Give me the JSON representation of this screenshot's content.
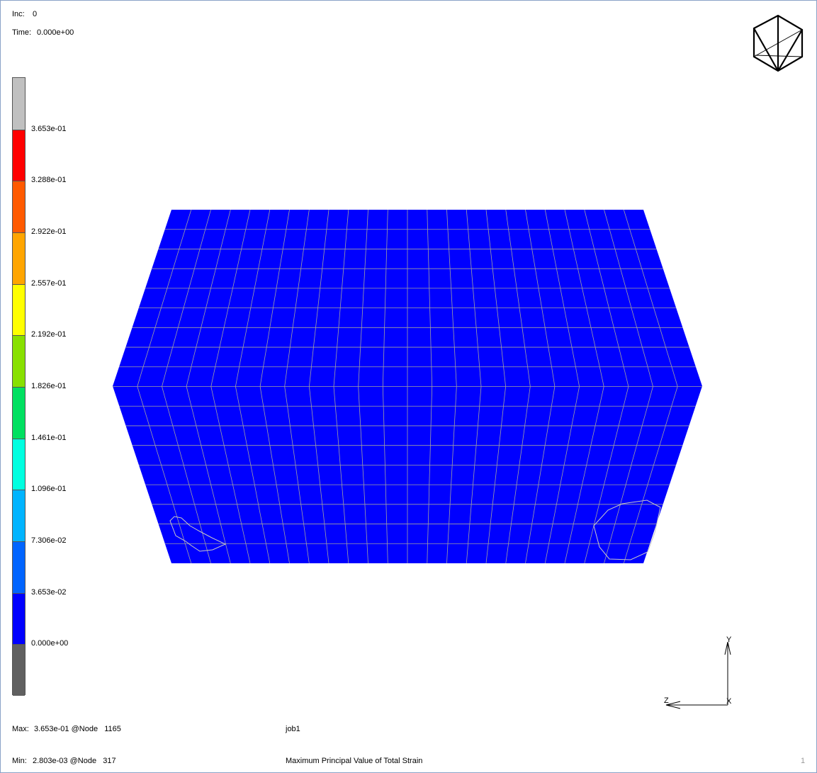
{
  "header": {
    "inc_label": "Inc:",
    "inc_value": "0",
    "time_label": "Time:",
    "time_value": "0.000e+00"
  },
  "legend": {
    "colors": [
      "#c0c0c0",
      "#ff0000",
      "#ff5a00",
      "#ffa500",
      "#ffff00",
      "#88e000",
      "#00e060",
      "#00ffe0",
      "#00b4ff",
      "#0064ff",
      "#0000ff",
      "#606060"
    ],
    "labels": [
      "3.653e-01",
      "3.288e-01",
      "2.922e-01",
      "2.557e-01",
      "2.192e-01",
      "1.826e-01",
      "1.461e-01",
      "1.096e-01",
      "7.306e-02",
      "3.653e-02",
      "0.000e+00"
    ]
  },
  "model": {
    "fill_color": "#0000ff",
    "mesh_line_color": "#a0a0a0"
  },
  "axes": {
    "y_label": "Y",
    "z_label": "Z",
    "x_label": "X"
  },
  "footer": {
    "max_label": "Max:",
    "max_value": "3.653e-01 @Node   1165",
    "min_label": "Min:",
    "min_value": "2.803e-03 @Node   317",
    "job_name": "job1",
    "result_title": "Maximum Principal Value of Total Strain",
    "page_number": "1"
  }
}
